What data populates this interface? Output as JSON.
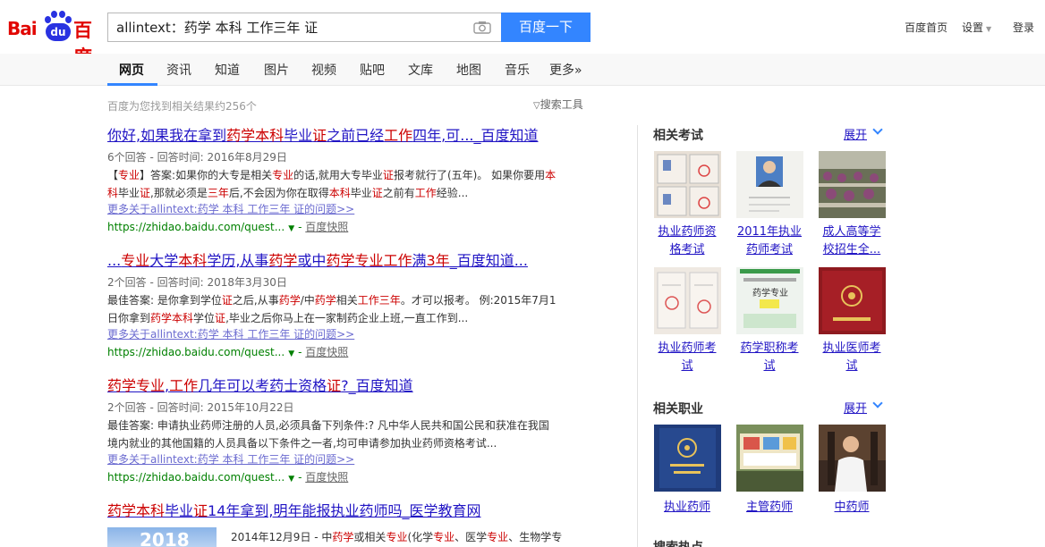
{
  "header": {
    "logo_text_left": "Bai",
    "logo_paw_text": "du",
    "logo_text_right": "百度",
    "search_value": "allintext：药学 本科 工作三年 证",
    "search_button": "百度一下",
    "links": [
      "百度首页",
      "设置",
      "登录"
    ]
  },
  "tabs": [
    "网页",
    "资讯",
    "知道",
    "图片",
    "视频",
    "贴吧",
    "文库",
    "地图",
    "音乐",
    "更多»"
  ],
  "results_count": "百度为您找到相关结果约256个",
  "search_tools": "搜索工具",
  "results": [
    {
      "title": "你好,如果我在拿到药学本科毕业证之前已经工作四年,可..._百度知道",
      "meta": "6个回答 - 回答时间: 2016年8月29日",
      "abs1": "【专业】答案:如果你的大专是相关专业的话,就用大专毕业证报考就行了(五年)。 如果你要用本",
      "abs2": "科毕业证,那就必须是三年后,不会因为你在取得本科毕业证之前有工作经验...",
      "more": "更多关于allintext:药学 本科 工作三年 证的问题>>",
      "url": "https://zhidao.baidu.com/quest...",
      "snapshot": "百度快照"
    },
    {
      "title": "...专业大学本科学历,从事药学或中药学专业工作满3年_百度知道...",
      "meta": "2个回答 - 回答时间: 2018年3月30日",
      "abs1": "最佳答案: 是你拿到学位证之后,从事药学/中药学相关工作三年。才可以报考。 例:2015年7月1",
      "abs2": "日你拿到药学本科学位证,毕业之后你马上在一家制药企业上班,一直工作到...",
      "more": "更多关于allintext:药学 本科 工作三年 证的问题>>",
      "url": "https://zhidao.baidu.com/quest...",
      "snapshot": "百度快照"
    },
    {
      "title": "药学专业,工作几年可以考药士资格证?_百度知道",
      "meta": "2个回答 - 回答时间: 2015年10月22日",
      "abs1": "最佳答案: 申请执业药师注册的人员,必须具备下列条件:? 凡中华人民共和国公民和获准在我国",
      "abs2": "境内就业的其他国籍的人员具备以下条件之一者,均可申请参加执业药师资格考试...",
      "more": "更多关于allintext:药学 本科 工作三年 证的问题>>",
      "url": "https://zhidao.baidu.com/quest...",
      "snapshot": "百度快照"
    },
    {
      "title": "药学本科毕业证14年拿到,明年能报执业药师吗_医学教育网",
      "thumb_text": "2018",
      "snippet": "2014年12月9日 - 中药学或相关专业(化学专业、医学专业、生物学专"
    }
  ],
  "side": {
    "exam_heading": "相关考试",
    "job_heading": "相关职业",
    "expand_label": "展开",
    "hot_heading": "搜索热点",
    "exams": [
      {
        "line1": "执业药师资",
        "line2": "格考试",
        "icon": "certificate-photo"
      },
      {
        "line1": "2011年执业",
        "line2": "药师考试",
        "icon": "id-photo"
      },
      {
        "line1": "成人高等学",
        "line2": "校招生全...",
        "icon": "exam-room-photo"
      },
      {
        "line1": "执业药师考",
        "line2": "试",
        "icon": "certificate-photo"
      },
      {
        "line1": "药学职称考",
        "line2": "试",
        "icon": "book-cover"
      },
      {
        "line1": "执业医师考",
        "line2": "试",
        "icon": "red-certificate"
      }
    ],
    "jobs": [
      {
        "label": "执业药师",
        "icon": "blue-certificate"
      },
      {
        "label": "主管药师",
        "icon": "bulletin-board-photo"
      },
      {
        "label": "中药师",
        "icon": "pharmacist-photo"
      }
    ]
  }
}
